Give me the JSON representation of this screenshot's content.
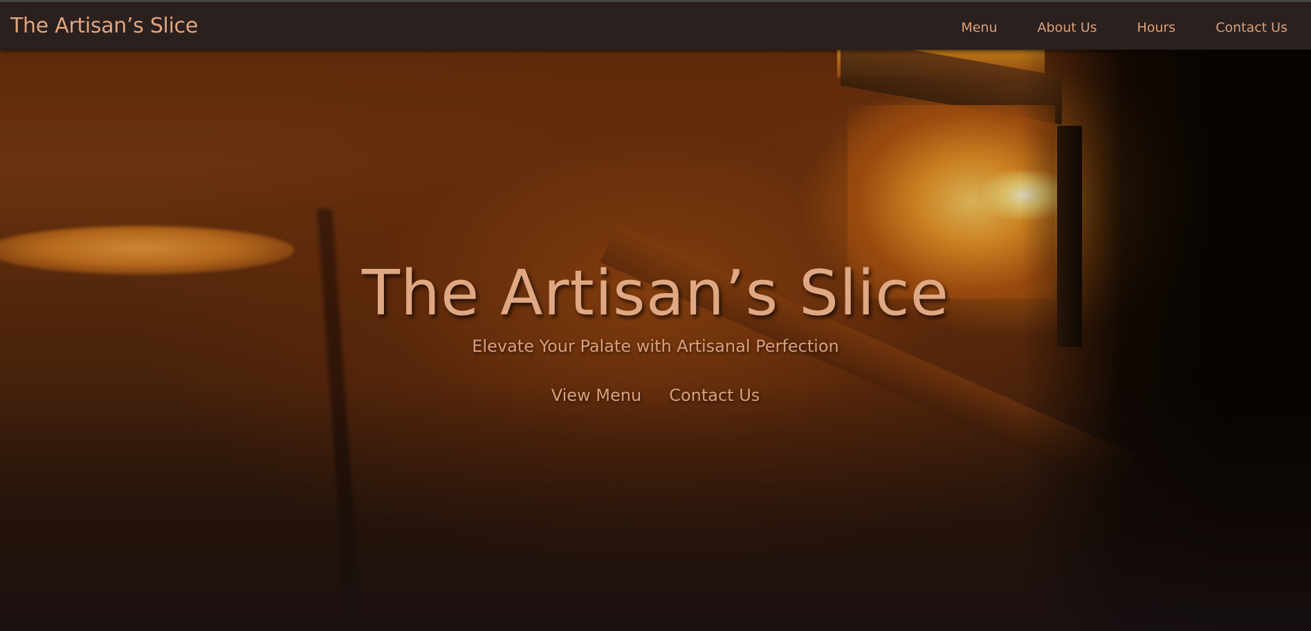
{
  "navbar": {
    "brand": "The Artisan’s Slice",
    "links": [
      "Menu",
      "About Us",
      "Hours",
      "Contact Us"
    ]
  },
  "hero": {
    "title": "The Artisan’s Slice",
    "subtitle": "Elevate Your Palate with Artisanal Perfection",
    "buttons": [
      "View Menu",
      "Contact Us"
    ],
    "background": "pizza-oven-fire-image"
  },
  "colors": {
    "accent": "#dfa882",
    "navbar_bg": "#2a201e"
  }
}
